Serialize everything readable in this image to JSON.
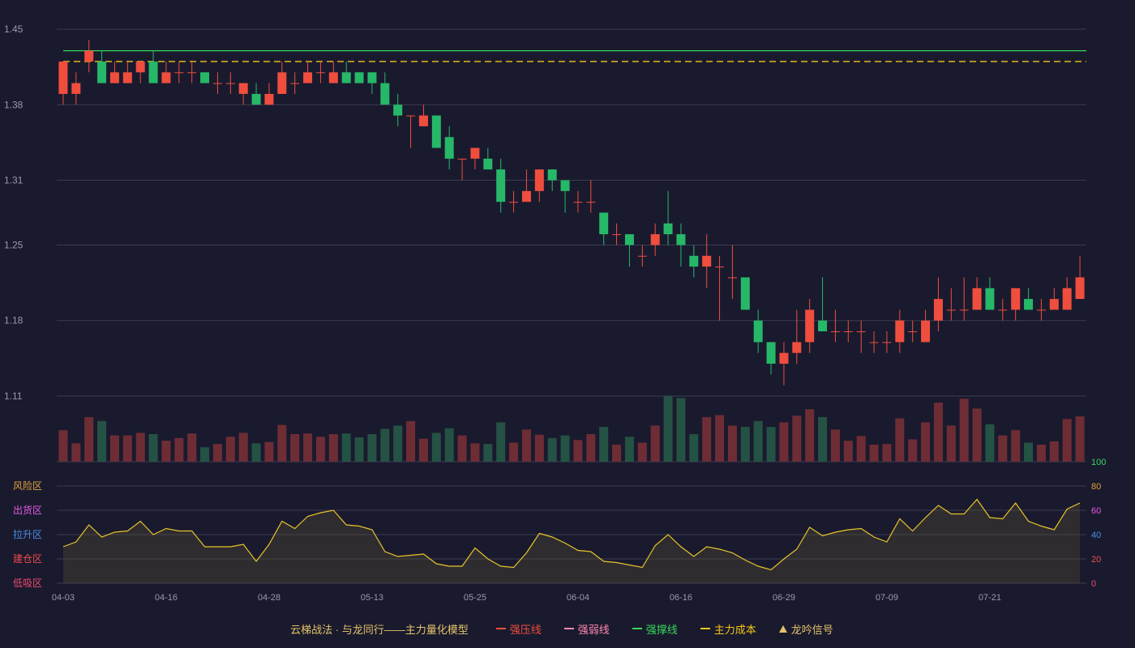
{
  "chart_data": {
    "type": "candlestick",
    "ylim": [
      1.11,
      1.45
    ],
    "yticks": [
      "1.45",
      "1.38",
      "1.31",
      "1.25",
      "1.18",
      "1.11"
    ],
    "xticks": [
      "04-03",
      "04-16",
      "04-28",
      "05-13",
      "05-25",
      "06-04",
      "06-16",
      "06-29",
      "07-09",
      "07-21"
    ],
    "xtick_index": [
      0,
      8,
      16,
      24,
      32,
      40,
      48,
      56,
      64,
      72
    ],
    "candles": [
      [
        1.39,
        1.42,
        1.38,
        1.42
      ],
      [
        1.39,
        1.4,
        1.38,
        1.41
      ],
      [
        1.42,
        1.43,
        1.41,
        1.44
      ],
      [
        1.42,
        1.4,
        1.4,
        1.43
      ],
      [
        1.4,
        1.41,
        1.4,
        1.42
      ],
      [
        1.4,
        1.41,
        1.4,
        1.42
      ],
      [
        1.41,
        1.42,
        1.4,
        1.42
      ],
      [
        1.42,
        1.4,
        1.4,
        1.43
      ],
      [
        1.4,
        1.41,
        1.4,
        1.42
      ],
      [
        1.41,
        1.41,
        1.4,
        1.42
      ],
      [
        1.41,
        1.41,
        1.4,
        1.42
      ],
      [
        1.41,
        1.4,
        1.4,
        1.41
      ],
      [
        1.4,
        1.4,
        1.39,
        1.41
      ],
      [
        1.4,
        1.4,
        1.39,
        1.41
      ],
      [
        1.39,
        1.4,
        1.38,
        1.4
      ],
      [
        1.39,
        1.38,
        1.38,
        1.4
      ],
      [
        1.38,
        1.39,
        1.38,
        1.4
      ],
      [
        1.39,
        1.41,
        1.39,
        1.42
      ],
      [
        1.4,
        1.4,
        1.39,
        1.41
      ],
      [
        1.4,
        1.41,
        1.4,
        1.42
      ],
      [
        1.41,
        1.41,
        1.4,
        1.42
      ],
      [
        1.4,
        1.41,
        1.4,
        1.42
      ],
      [
        1.41,
        1.4,
        1.4,
        1.42
      ],
      [
        1.41,
        1.4,
        1.4,
        1.41
      ],
      [
        1.41,
        1.4,
        1.39,
        1.41
      ],
      [
        1.4,
        1.38,
        1.38,
        1.41
      ],
      [
        1.38,
        1.37,
        1.36,
        1.39
      ],
      [
        1.37,
        1.37,
        1.34,
        1.37
      ],
      [
        1.36,
        1.37,
        1.36,
        1.38
      ],
      [
        1.37,
        1.34,
        1.34,
        1.37
      ],
      [
        1.35,
        1.33,
        1.32,
        1.36
      ],
      [
        1.33,
        1.33,
        1.31,
        1.33
      ],
      [
        1.33,
        1.34,
        1.32,
        1.34
      ],
      [
        1.33,
        1.32,
        1.32,
        1.34
      ],
      [
        1.32,
        1.29,
        1.28,
        1.33
      ],
      [
        1.29,
        1.29,
        1.28,
        1.3
      ],
      [
        1.29,
        1.3,
        1.29,
        1.32
      ],
      [
        1.3,
        1.32,
        1.29,
        1.32
      ],
      [
        1.32,
        1.31,
        1.3,
        1.32
      ],
      [
        1.31,
        1.3,
        1.28,
        1.31
      ],
      [
        1.29,
        1.29,
        1.28,
        1.3
      ],
      [
        1.29,
        1.29,
        1.28,
        1.31
      ],
      [
        1.28,
        1.26,
        1.25,
        1.28
      ],
      [
        1.26,
        1.26,
        1.25,
        1.27
      ],
      [
        1.26,
        1.25,
        1.23,
        1.26
      ],
      [
        1.24,
        1.24,
        1.23,
        1.25
      ],
      [
        1.25,
        1.26,
        1.24,
        1.27
      ],
      [
        1.27,
        1.26,
        1.25,
        1.3
      ],
      [
        1.26,
        1.25,
        1.23,
        1.27
      ],
      [
        1.24,
        1.23,
        1.22,
        1.25
      ],
      [
        1.23,
        1.24,
        1.21,
        1.26
      ],
      [
        1.23,
        1.23,
        1.18,
        1.24
      ],
      [
        1.22,
        1.22,
        1.2,
        1.25
      ],
      [
        1.22,
        1.19,
        1.19,
        1.22
      ],
      [
        1.18,
        1.16,
        1.15,
        1.19
      ],
      [
        1.16,
        1.14,
        1.13,
        1.16
      ],
      [
        1.14,
        1.15,
        1.12,
        1.16
      ],
      [
        1.15,
        1.16,
        1.14,
        1.19
      ],
      [
        1.16,
        1.19,
        1.15,
        1.2
      ],
      [
        1.18,
        1.17,
        1.17,
        1.22
      ],
      [
        1.17,
        1.17,
        1.16,
        1.19
      ],
      [
        1.17,
        1.17,
        1.16,
        1.18
      ],
      [
        1.17,
        1.17,
        1.15,
        1.18
      ],
      [
        1.16,
        1.16,
        1.15,
        1.17
      ],
      [
        1.16,
        1.16,
        1.15,
        1.17
      ],
      [
        1.16,
        1.18,
        1.15,
        1.19
      ],
      [
        1.17,
        1.17,
        1.16,
        1.18
      ],
      [
        1.16,
        1.18,
        1.16,
        1.19
      ],
      [
        1.18,
        1.2,
        1.17,
        1.22
      ],
      [
        1.19,
        1.19,
        1.18,
        1.21
      ],
      [
        1.19,
        1.19,
        1.18,
        1.22
      ],
      [
        1.19,
        1.21,
        1.19,
        1.22
      ],
      [
        1.21,
        1.19,
        1.19,
        1.22
      ],
      [
        1.19,
        1.19,
        1.18,
        1.2
      ],
      [
        1.19,
        1.21,
        1.18,
        1.21
      ],
      [
        1.2,
        1.19,
        1.19,
        1.21
      ],
      [
        1.19,
        1.19,
        1.18,
        1.2
      ],
      [
        1.19,
        1.2,
        1.19,
        1.21
      ],
      [
        1.19,
        1.21,
        1.19,
        1.22
      ],
      [
        1.2,
        1.22,
        1.2,
        1.24
      ]
    ],
    "volume": [
      0.48,
      0.28,
      0.68,
      0.62,
      0.4,
      0.4,
      0.44,
      0.42,
      0.32,
      0.36,
      0.43,
      0.22,
      0.27,
      0.38,
      0.44,
      0.28,
      0.3,
      0.56,
      0.42,
      0.43,
      0.38,
      0.42,
      0.43,
      0.37,
      0.42,
      0.5,
      0.55,
      0.62,
      0.35,
      0.44,
      0.51,
      0.4,
      0.28,
      0.27,
      0.6,
      0.29,
      0.49,
      0.41,
      0.36,
      0.4,
      0.33,
      0.42,
      0.53,
      0.26,
      0.38,
      0.29,
      0.55,
      1.0,
      0.97,
      0.42,
      0.68,
      0.71,
      0.55,
      0.53,
      0.62,
      0.53,
      0.6,
      0.7,
      0.8,
      0.68,
      0.49,
      0.32,
      0.39,
      0.26,
      0.27,
      0.66,
      0.34,
      0.6,
      0.9,
      0.55,
      0.96,
      0.81,
      0.57,
      0.4,
      0.48,
      0.29,
      0.26,
      0.31,
      0.65,
      0.69
    ],
    "indicator": [
      30,
      34,
      48,
      38,
      42,
      43,
      51,
      40,
      45,
      43,
      43,
      30,
      30,
      30,
      32,
      18,
      32,
      51,
      45,
      55,
      58,
      60,
      48,
      47,
      44,
      26,
      22,
      23,
      24,
      16,
      14,
      14,
      29,
      20,
      14,
      13,
      25,
      41,
      38,
      33,
      27,
      26,
      18,
      17,
      15,
      13,
      31,
      40,
      30,
      22,
      30,
      28,
      25,
      19,
      14,
      11,
      20,
      28,
      46,
      39,
      42,
      44,
      45,
      38,
      34,
      53,
      43,
      54,
      64,
      57,
      57,
      69,
      54,
      53,
      66,
      51,
      47,
      44,
      61,
      66
    ],
    "indicator_ylim": [
      0,
      100
    ],
    "indicator_yticks": [
      "100",
      "80",
      "60",
      "40",
      "20",
      "0"
    ],
    "zones": [
      "风险区",
      "出货区",
      "拉升区",
      "建仓区",
      "低吸区"
    ],
    "lines": {
      "strong_support": 1.43,
      "main_cost": 1.42
    },
    "legend": {
      "title": "云梯战法 · 与龙同行——主力量化模型",
      "items": [
        "强压线",
        "强弱线",
        "强撑线",
        "主力成本",
        "龙吟信号"
      ]
    },
    "colors": {
      "up": "#ef4e3e",
      "down": "#26b868",
      "vol_up": "#6e2d35",
      "vol_down": "#245244",
      "support_line": "#37d75b",
      "cost_line": "#f5c518",
      "indicator": "#e6c42a",
      "grid": "#3c3c50",
      "axis_text": "#9a9aa8",
      "background": "#1a1a2e",
      "zone_risk": "#e2a23a",
      "zone_sell": "#e65ae6",
      "zone_up": "#4a8fe6",
      "zone_build": "#f04b4b",
      "zone_buy": "#f04b6e",
      "legend_resist": "#ef4e3e",
      "legend_weak": "#ff8ab0",
      "legend_support": "#37d75b",
      "legend_cost": "#f5c518",
      "legend_signal": "#e2c469"
    }
  }
}
